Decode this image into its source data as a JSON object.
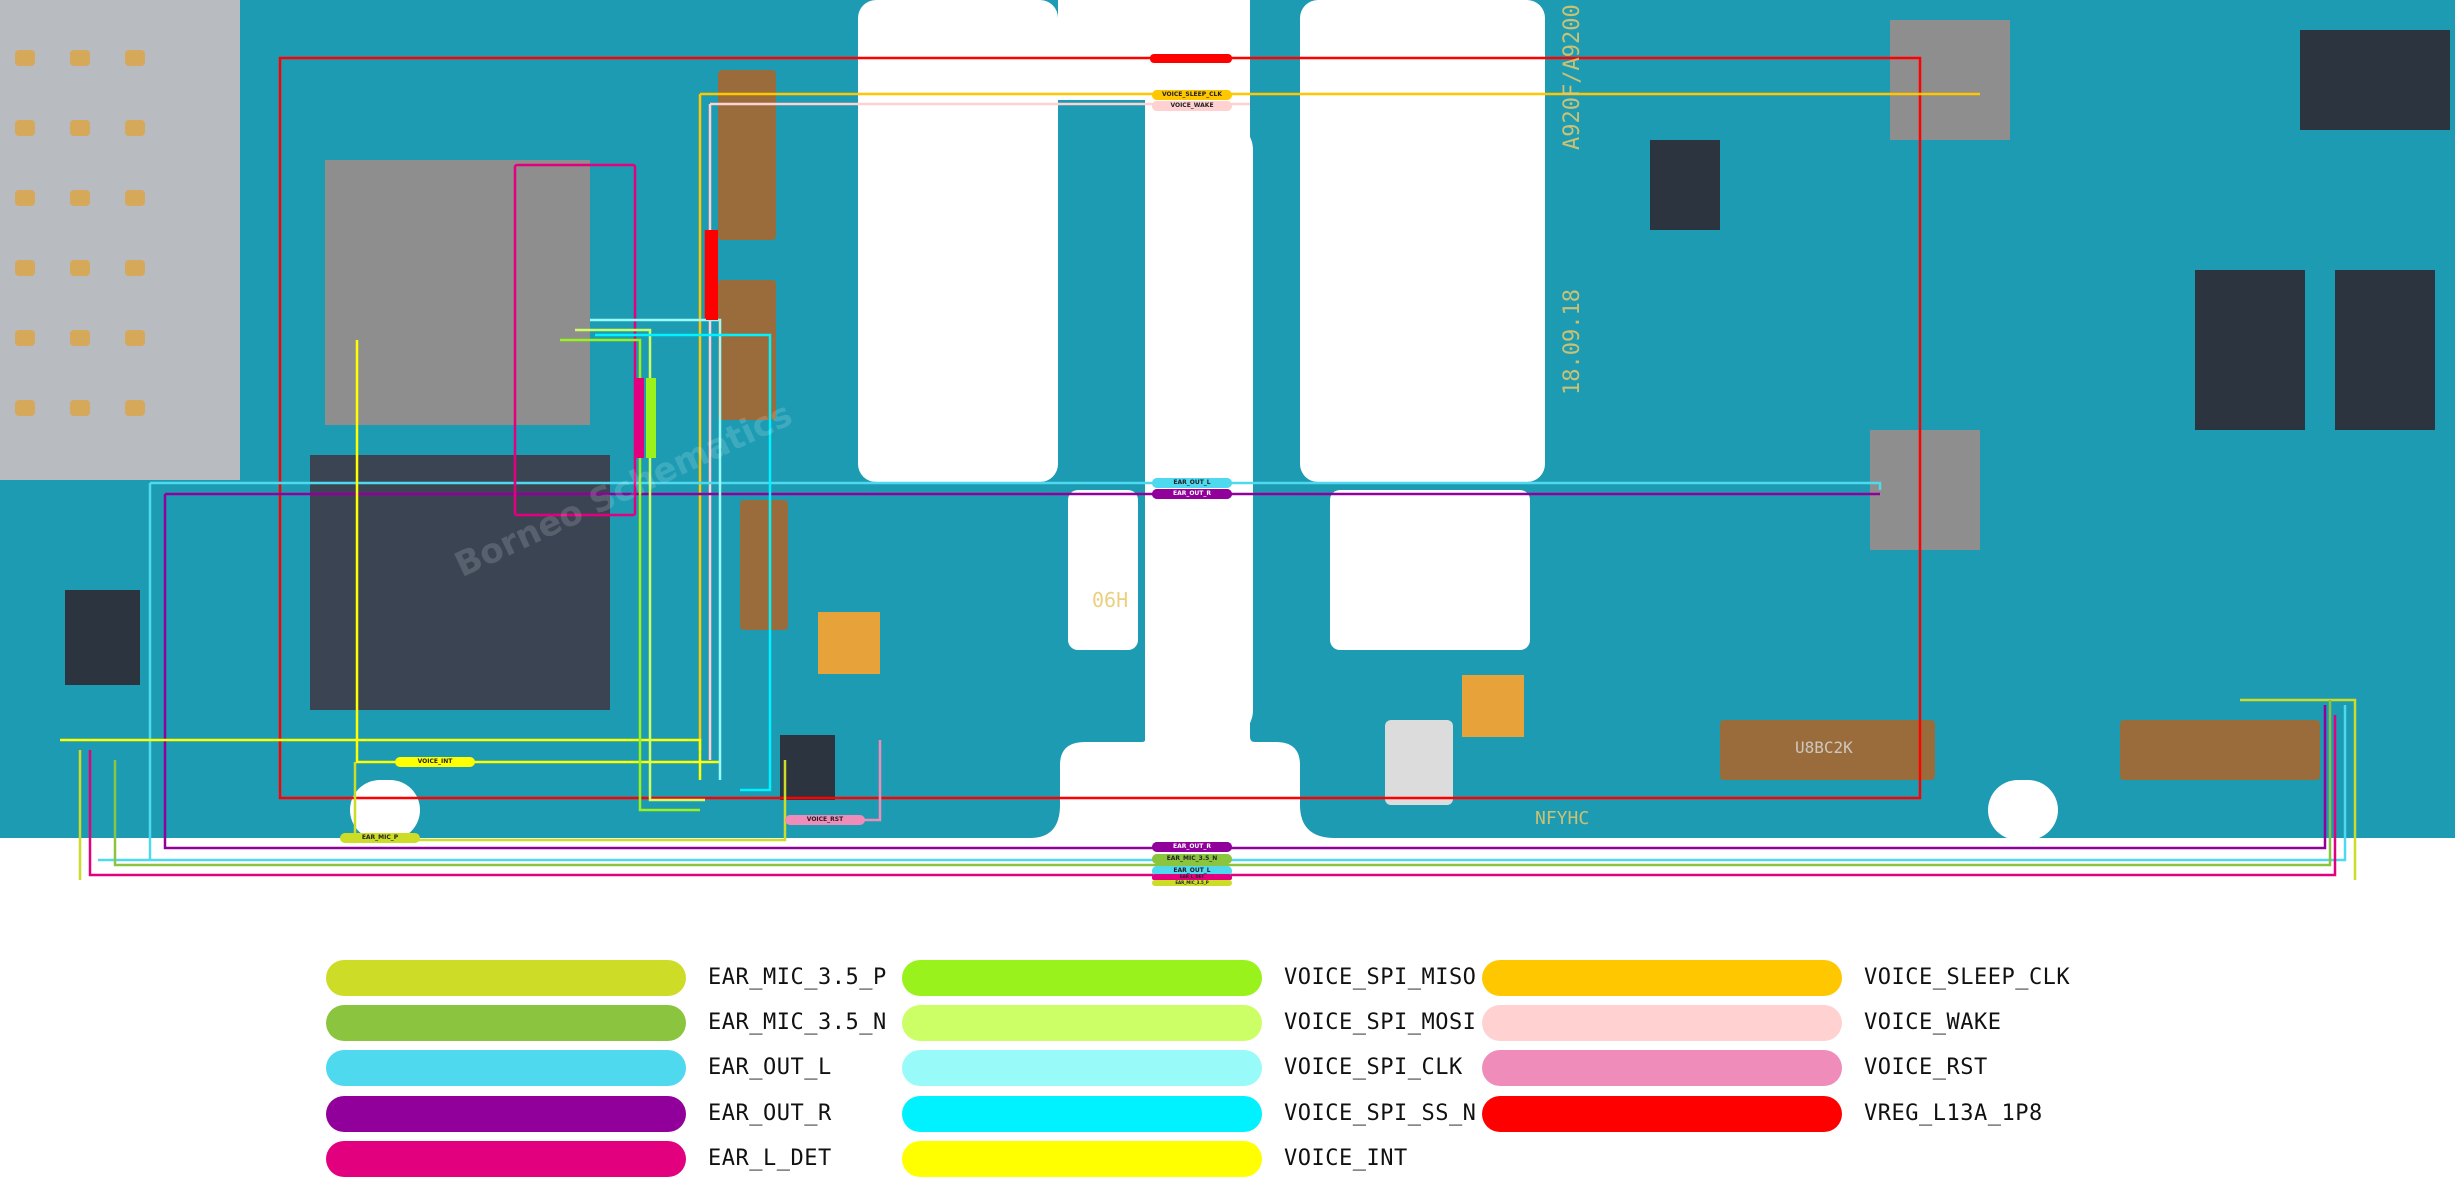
{
  "board": {
    "silkscreen": {
      "model": "A920F/A9200 06H",
      "date": "18.09.18",
      "board_code": "06H",
      "bottom_code": "NFYHC",
      "connector_code": "U8BC2K"
    },
    "watermark": "Borneo Schematics",
    "trace_labels": [
      {
        "text": "VOICE_SLEEP_CLK",
        "net": "VOICE_SLEEP_CLK"
      },
      {
        "text": "VOICE_WAKE",
        "net": "VOICE_WAKE"
      },
      {
        "text": "EAR_OUT_L",
        "net": "EAR_OUT_L"
      },
      {
        "text": "EAR_OUT_R",
        "net": "EAR_OUT_R"
      },
      {
        "text": "VOICE_INT",
        "net": "VOICE_INT"
      },
      {
        "text": "VOICE_RST",
        "net": "VOICE_RST"
      },
      {
        "text": "EAR_MIC_P",
        "net": "EAR_MIC_3.5_P"
      },
      {
        "text": "EAR_OUT_R",
        "net": "EAR_OUT_R"
      },
      {
        "text": "EAR_MIC_3.5_N",
        "net": "EAR_MIC_3.5_N"
      },
      {
        "text": "EAR_OUT_L",
        "net": "EAR_OUT_L"
      },
      {
        "text": "EAR_L_DET",
        "net": "EAR_L_DET"
      },
      {
        "text": "EAR_MIC_3.5_P",
        "net": "EAR_MIC_3.5_P"
      }
    ]
  },
  "legend": {
    "items": [
      {
        "label": "EAR_MIC_3.5_P",
        "color": "#cddc27"
      },
      {
        "label": "EAR_MIC_3.5_N",
        "color": "#8bc540"
      },
      {
        "label": "EAR_OUT_L",
        "color": "#4fd9ee"
      },
      {
        "label": "EAR_OUT_R",
        "color": "#91009a"
      },
      {
        "label": "EAR_L_DET",
        "color": "#e3007e"
      },
      {
        "label": "VOICE_SPI_MISO",
        "color": "#99f21b"
      },
      {
        "label": "VOICE_SPI_MOSI",
        "color": "#ccff66"
      },
      {
        "label": "VOICE_SPI_CLK",
        "color": "#99fbf9"
      },
      {
        "label": "VOICE_SPI_SS_N",
        "color": "#00f1ff"
      },
      {
        "label": "VOICE_INT",
        "color": "#ffff00"
      },
      {
        "label": "VOICE_SLEEP_CLK",
        "color": "#ffc700"
      },
      {
        "label": "VOICE_WAKE",
        "color": "#ffd1d1"
      },
      {
        "label": "VOICE_RST",
        "color": "#f08cba"
      },
      {
        "label": "VREG_L13A_1P8",
        "color": "#ff0000"
      }
    ]
  }
}
